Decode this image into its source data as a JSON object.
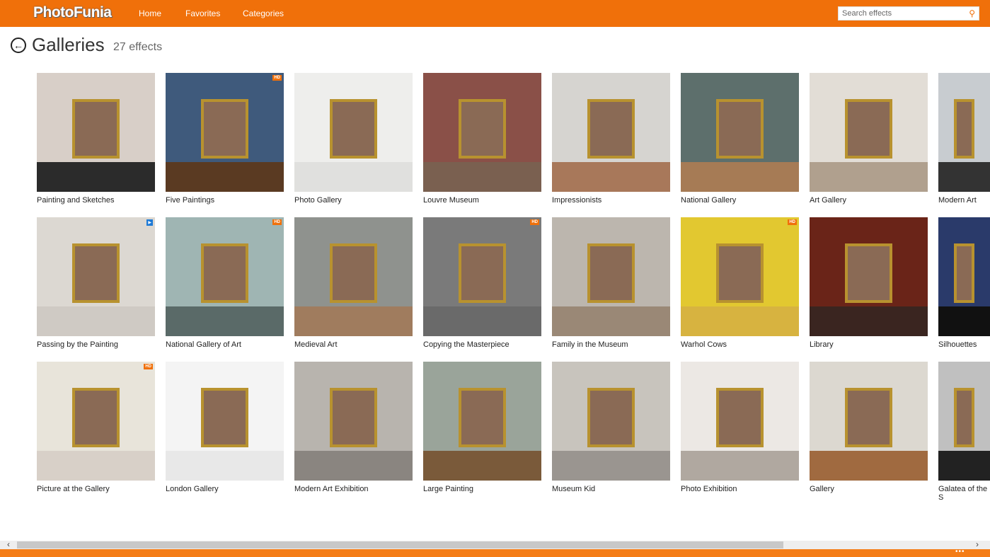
{
  "header": {
    "logo": "PhotoFunia",
    "nav": [
      "Home",
      "Favorites",
      "Categories"
    ],
    "search_placeholder": "Search effects",
    "brand_color": "#f0700a"
  },
  "page": {
    "title": "Galleries",
    "count": "27 effects"
  },
  "tiles": [
    {
      "label": "Painting and Sketches",
      "badge": "",
      "wall": "#d8cfc8",
      "floor": "#2b2b2b"
    },
    {
      "label": "Five Paintings",
      "badge": "HD",
      "wall": "#3f5a7c",
      "floor": "#5a3a22"
    },
    {
      "label": "Photo Gallery",
      "badge": "",
      "wall": "#eeeeec",
      "floor": "#e0e0de"
    },
    {
      "label": "Louvre Museum",
      "badge": "",
      "wall": "#8a5048",
      "floor": "#7a6050"
    },
    {
      "label": "Impressionists",
      "badge": "",
      "wall": "#d6d4d0",
      "floor": "#a8785a"
    },
    {
      "label": "National Gallery",
      "badge": "",
      "wall": "#5d6f6c",
      "floor": "#a67b55"
    },
    {
      "label": "Art Gallery",
      "badge": "",
      "wall": "#e2ddd6",
      "floor": "#b0a08e"
    },
    {
      "label": "Modern Art",
      "badge": "",
      "wall": "#c8ccd0",
      "floor": "#333333"
    },
    {
      "label": "Passing by the Painting",
      "badge": "video",
      "wall": "#dcd8d2",
      "floor": "#cfcac4"
    },
    {
      "label": "National Gallery of Art",
      "badge": "HD",
      "wall": "#9fb5b3",
      "floor": "#5a6a68"
    },
    {
      "label": "Medieval Art",
      "badge": "",
      "wall": "#8f928e",
      "floor": "#a07c5e"
    },
    {
      "label": "Copying the Masterpiece",
      "badge": "HD",
      "wall": "#7a7a7a",
      "floor": "#6a6a6a"
    },
    {
      "label": "Family in the Museum",
      "badge": "",
      "wall": "#bcb6ae",
      "floor": "#9a8876"
    },
    {
      "label": "Warhol Cows",
      "badge": "HD",
      "wall": "#e2c830",
      "floor": "#d7b340"
    },
    {
      "label": "Library",
      "badge": "",
      "wall": "#6a2418",
      "floor": "#3a2520"
    },
    {
      "label": "Silhouettes",
      "badge": "",
      "wall": "#2a3a6a",
      "floor": "#111111"
    },
    {
      "label": "Picture at the Gallery",
      "badge": "HD",
      "wall": "#e8e4da",
      "floor": "#d8d0c8"
    },
    {
      "label": "London Gallery",
      "badge": "",
      "wall": "#f4f4f4",
      "floor": "#e8e8e8"
    },
    {
      "label": "Modern Art Exhibition",
      "badge": "",
      "wall": "#b8b4ae",
      "floor": "#8a8580"
    },
    {
      "label": "Large Painting",
      "badge": "",
      "wall": "#9aa49a",
      "floor": "#7a5a3a"
    },
    {
      "label": "Museum Kid",
      "badge": "",
      "wall": "#c8c4bd",
      "floor": "#9a9590"
    },
    {
      "label": "Photo Exhibition",
      "badge": "",
      "wall": "#ece8e4",
      "floor": "#b0a8a0"
    },
    {
      "label": "Gallery",
      "badge": "",
      "wall": "#dcd8d0",
      "floor": "#a06a40"
    },
    {
      "label": "Galatea of the S",
      "badge": "",
      "wall": "#c0c0c0",
      "floor": "#222222"
    }
  ]
}
